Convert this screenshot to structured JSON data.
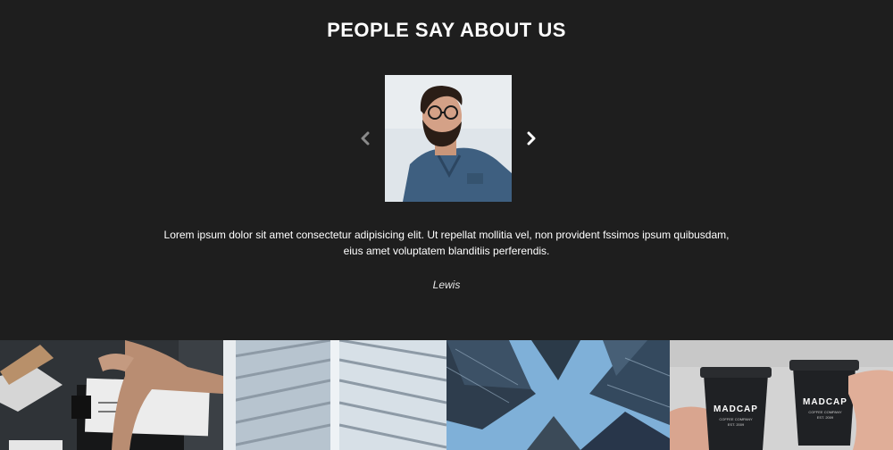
{
  "testimonials": {
    "title": "PEOPLE SAY ABOUT US",
    "quote": "Lorem ipsum dolor sit amet consectetur adipisicing elit. Ut repellat mollitia vel, non provident fssimos ipsum quibusdam, eius amet voluptatem blanditiis perferendis.",
    "author": "Lewis",
    "prev_icon": "chevron-left-icon",
    "next_icon": "chevron-right-icon"
  },
  "gallery": {
    "tiles": [
      "desk-paperwork-photo",
      "skyscraper-facade-photo",
      "skyscrapers-upward-photo",
      "coffee-cups-photo"
    ],
    "cup_brand": "MADCAP",
    "cup_subtitle": "COFFEE COMPANY",
    "cup_year": "EST. 2009"
  },
  "colors": {
    "background": "#1e1e1e",
    "text": "#ffffff",
    "arrow_inactive": "#8a8a8a"
  }
}
